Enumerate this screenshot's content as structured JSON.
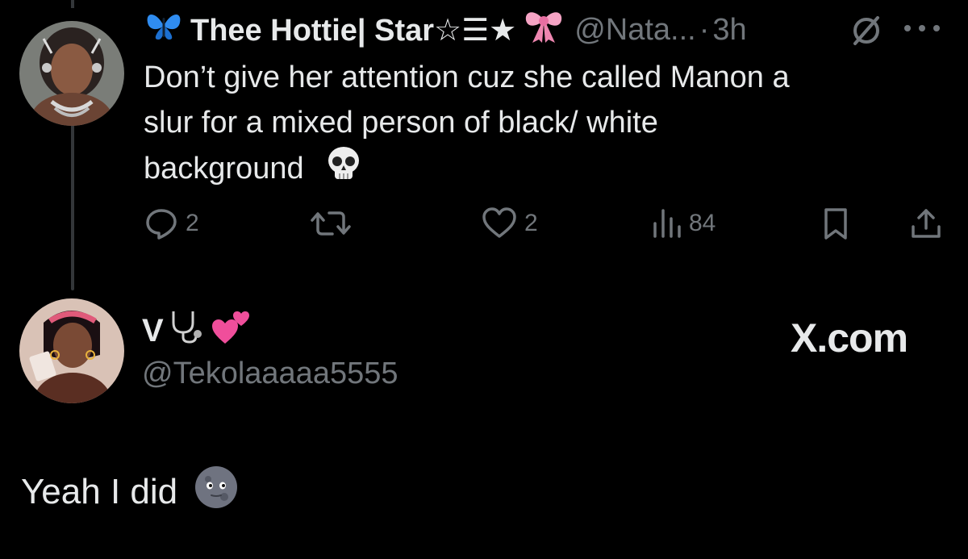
{
  "parent_tweet": {
    "display_name": "Thee Hottie| Star☆☰★",
    "handle": "@Nata...",
    "separator": "·",
    "time": "3h",
    "body_lines": [
      "Don’t give her attention cuz she called Manon a",
      "slur for a mixed person of black/ white",
      "background"
    ],
    "actions": {
      "replies": "2",
      "retweets": "",
      "likes": "2",
      "views": "84"
    },
    "icons": {
      "butterfly": "butterfly-emoji",
      "bow": "pink-bow-emoji",
      "skull": "skull-emoji",
      "grok": "grok-icon",
      "more": "more-icon"
    }
  },
  "reply": {
    "display_name": "V",
    "handle": "@Tekolaaaaa5555",
    "watermark": "X.com",
    "text": "Yeah I did",
    "icons": {
      "stethoscope": "stethoscope-emoji",
      "hearts": "two-hearts-emoji",
      "moon": "new-moon-face-emoji"
    }
  },
  "colors": {
    "background": "#000000",
    "text": "#e7e9ea",
    "secondary": "#71767b",
    "thread_line": "#333639"
  }
}
